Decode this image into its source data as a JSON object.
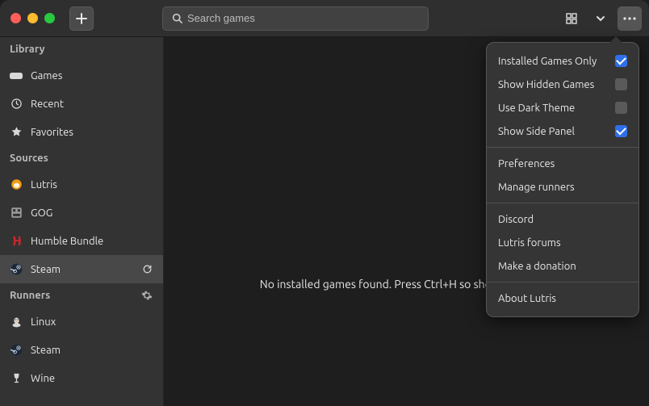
{
  "header": {
    "search_placeholder": "Search games"
  },
  "sidebar": {
    "library": {
      "header": "Library",
      "items": [
        {
          "icon": "gamepad-icon",
          "label": "Games"
        },
        {
          "icon": "clock-icon",
          "label": "Recent"
        },
        {
          "icon": "star-icon",
          "label": "Favorites"
        }
      ]
    },
    "sources": {
      "header": "Sources",
      "items": [
        {
          "icon": "lutris-icon",
          "label": "Lutris"
        },
        {
          "icon": "gog-icon",
          "label": "GOG"
        },
        {
          "icon": "humble-icon",
          "label": "Humble Bundle"
        },
        {
          "icon": "steam-icon",
          "label": "Steam",
          "selected": true
        }
      ]
    },
    "runners": {
      "header": "Runners",
      "items": [
        {
          "icon": "linux-icon",
          "label": "Linux"
        },
        {
          "icon": "steam-icon",
          "label": "Steam"
        },
        {
          "icon": "wine-icon",
          "label": "Wine"
        }
      ]
    }
  },
  "main": {
    "empty_text": "No installed games found. Press Ctrl+H so show all games."
  },
  "menu": {
    "toggles": [
      {
        "label": "Installed Games Only",
        "checked": true
      },
      {
        "label": "Show Hidden Games",
        "checked": false
      },
      {
        "label": "Use Dark Theme",
        "checked": false
      },
      {
        "label": "Show Side Panel",
        "checked": true
      }
    ],
    "groups": [
      [
        "Preferences",
        "Manage runners"
      ],
      [
        "Discord",
        "Lutris forums",
        "Make a donation"
      ],
      [
        "About Lutris"
      ]
    ]
  }
}
